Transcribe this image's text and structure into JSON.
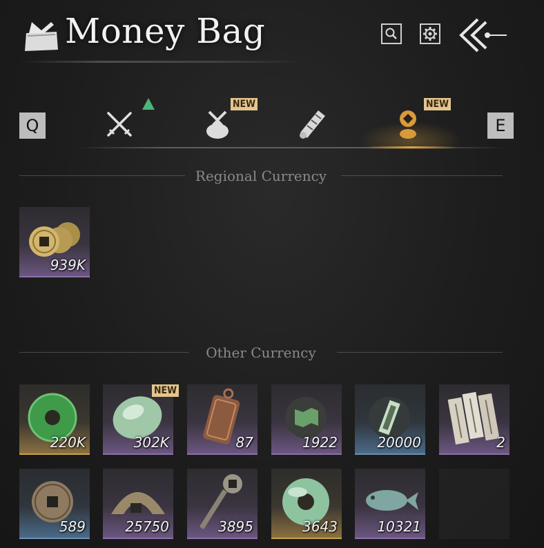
{
  "header": {
    "title": "Money Bag",
    "icons": [
      "money-bag-icon",
      "search-icon",
      "gear-icon",
      "back-arrow-icon"
    ]
  },
  "tabs": {
    "prev_key": "Q",
    "next_key": "E",
    "items": [
      {
        "name": "weapons",
        "icon": "crossed-swords-icon",
        "badge": "arrow-up"
      },
      {
        "name": "bundle",
        "icon": "bundle-icon",
        "badge": "NEW"
      },
      {
        "name": "scroll",
        "icon": "scroll-icon",
        "badge": ""
      },
      {
        "name": "currency",
        "icon": "coin-icon",
        "badge": "NEW",
        "active": true
      }
    ],
    "new_label": "NEW"
  },
  "sections": {
    "regional": {
      "label": "Regional Currency",
      "items": [
        {
          "icon": "coin-stack-icon",
          "count": "939K",
          "rarity": "purple"
        }
      ]
    },
    "other": {
      "label": "Other Currency",
      "items": [
        {
          "icon": "jade-disc-icon",
          "count": "220K",
          "rarity": "gold"
        },
        {
          "icon": "jade-pebble-icon",
          "count": "302K",
          "rarity": "purple",
          "badge": "NEW"
        },
        {
          "icon": "bronze-token-icon",
          "count": "87",
          "rarity": "purple"
        },
        {
          "icon": "map-tile-icon",
          "count": "1922",
          "rarity": "purple"
        },
        {
          "icon": "jade-tag-icon",
          "count": "20000",
          "rarity": "blue"
        },
        {
          "icon": "paper-slips-icon",
          "count": "2",
          "rarity": "purple"
        },
        {
          "icon": "square-hole-coin-icon",
          "count": "589",
          "rarity": "blue"
        },
        {
          "icon": "bronze-arc-icon",
          "count": "25750",
          "rarity": "purple"
        },
        {
          "icon": "coin-sword-icon",
          "count": "3895",
          "rarity": "purple"
        },
        {
          "icon": "jade-ring-icon",
          "count": "3643",
          "rarity": "gold"
        },
        {
          "icon": "jade-fish-icon",
          "count": "10321",
          "rarity": "purple"
        },
        {
          "icon": "",
          "count": "",
          "rarity": "empty"
        }
      ]
    }
  },
  "colors": {
    "accent_gold": "#d9a24a",
    "new_badge": "#e4c590",
    "rarity_purple": "#8c70a8",
    "rarity_gold": "#c9a24a",
    "rarity_blue": "#6d90b0"
  }
}
